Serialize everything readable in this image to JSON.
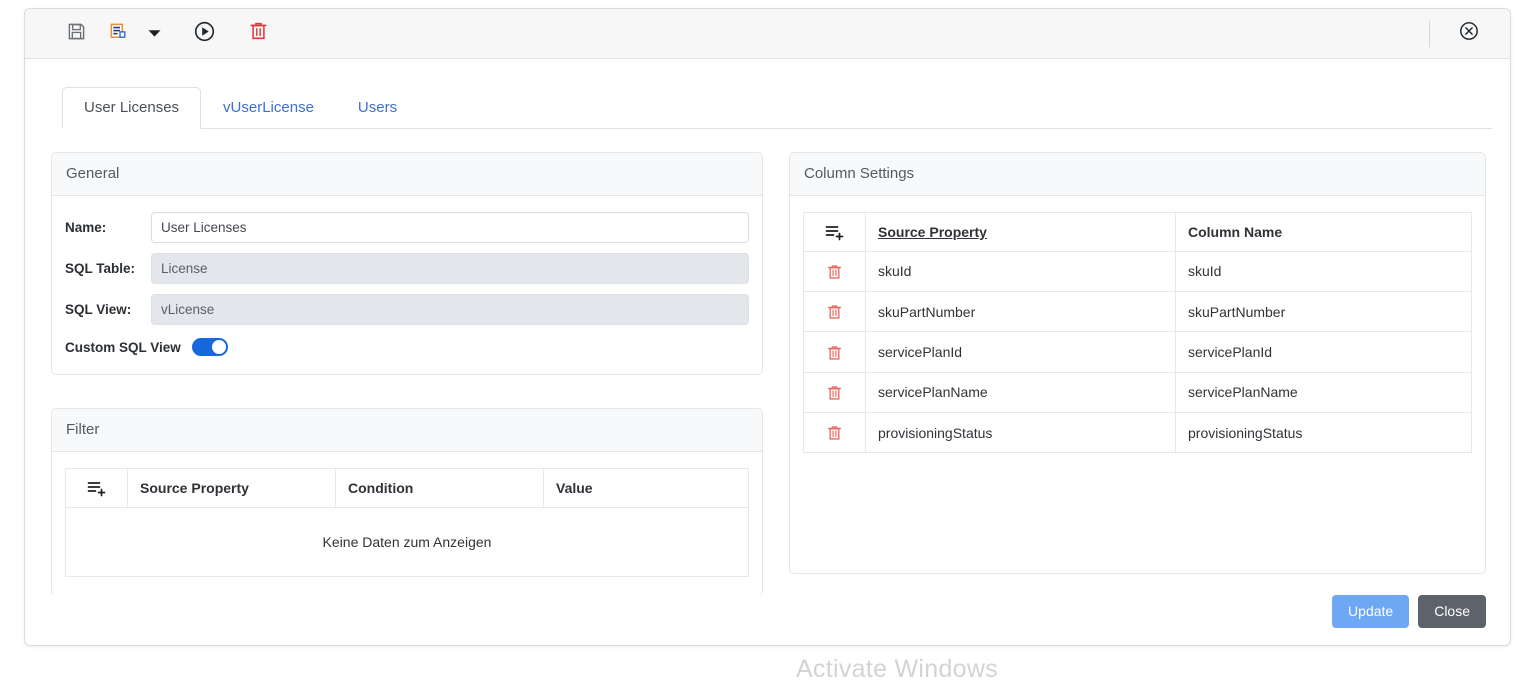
{
  "toolbar": {
    "save": {
      "name": "save-icon",
      "title": "Save"
    },
    "save_as": {
      "name": "save-as-icon",
      "title": "Save As"
    },
    "save_as_caret": {
      "name": "chevron-down-icon",
      "title": "More save options"
    },
    "run": {
      "name": "play-circle-icon",
      "title": "Run"
    },
    "delete": {
      "name": "trash-icon",
      "title": "Delete"
    },
    "close": {
      "name": "close-circle-icon",
      "title": "Close"
    }
  },
  "tabs": [
    {
      "label": "User Licenses",
      "active": true
    },
    {
      "label": "vUserLicense",
      "active": false
    },
    {
      "label": "Users",
      "active": false
    }
  ],
  "general": {
    "title": "General",
    "fields": [
      {
        "label": "Name:",
        "value": "User Licenses",
        "disabled": false
      },
      {
        "label": "SQL Table:",
        "value": "License",
        "disabled": true
      },
      {
        "label": "SQL View:",
        "value": "vLicense",
        "disabled": true
      }
    ],
    "toggle": {
      "label": "Custom SQL View",
      "checked": true,
      "color": "#1668dc"
    }
  },
  "filter": {
    "title": "Filter",
    "add_icon": "add-rows-icon",
    "columns": [
      "Source Property",
      "Condition",
      "Value"
    ],
    "rows": [],
    "empty_text": "Keine Daten zum Anzeigen"
  },
  "column_settings": {
    "title": "Column Settings",
    "add_icon": "add-rows-icon",
    "columns": [
      {
        "label": "Source Property",
        "sorted": true
      },
      {
        "label": "Column Name",
        "sorted": false
      }
    ],
    "rows": [
      {
        "delete_icon": "trash-icon",
        "source_property": "skuId",
        "column_name": "skuId"
      },
      {
        "delete_icon": "trash-icon",
        "source_property": "skuPartNumber",
        "column_name": "skuPartNumber"
      },
      {
        "delete_icon": "trash-icon",
        "source_property": "servicePlanId",
        "column_name": "servicePlanId"
      },
      {
        "delete_icon": "trash-icon",
        "source_property": "servicePlanName",
        "column_name": "servicePlanName"
      },
      {
        "delete_icon": "trash-icon",
        "source_property": "provisioningStatus",
        "column_name": "provisioningStatus"
      }
    ]
  },
  "footer": {
    "update_label": "Update",
    "close_label": "Close",
    "update_color": "#6ea8f5",
    "close_color": "#5d636b"
  },
  "watermark": {
    "text": "Activate Windows"
  }
}
